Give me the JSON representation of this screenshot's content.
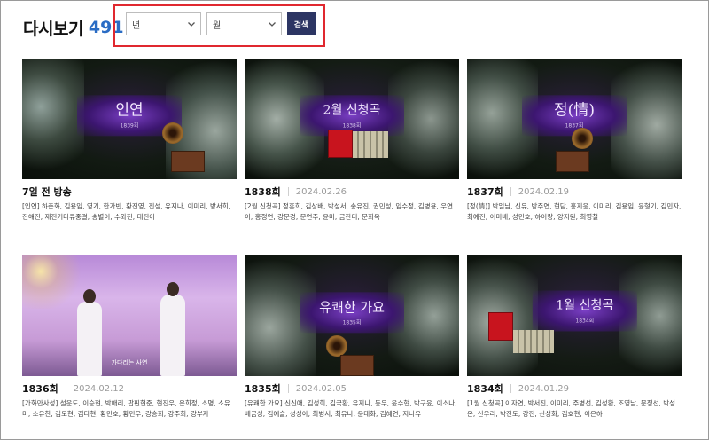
{
  "header": {
    "title": "다시보기",
    "count": "491"
  },
  "filters": {
    "year": "년",
    "month": "월",
    "search_label": "검색"
  },
  "cards": [
    {
      "banner_title": "인연",
      "banner_sub": "1839회",
      "episode": "7일 전 방송",
      "date": "",
      "cast": "[인연] 하춘화, 김용임, 영기, 한가빈, 황진영, 진성, 유지나, 이미리, 방서희, 진해진, 재진기타류중걸, 송별이, 수와진, 태진아"
    },
    {
      "banner_title": "2월 신청곡",
      "banner_sub": "1838회",
      "episode": "1838회",
      "date": "2024.02.26",
      "cast": "[2월 신청곡] 정훈희, 김상배, 박성서, 송유진, 권민성, 임수정, 김병용, 우연이, 홍정연, 강문경, 문연주, 윤미, 금잔디, 문희옥"
    },
    {
      "banner_title": "정(情)",
      "banner_sub": "1837회",
      "episode": "1837회",
      "date": "2024.02.19",
      "cast": "[정(情)] 박일남, 신유, 방주연, 현담, 홍지윤, 이미리, 김용임, 윤형기, 김민자, 최예진, 이미배, 성민호, 하이량, 양지원, 최영철"
    },
    {
      "banner_title": "",
      "banner_sub": "",
      "caption": "가다리는 사연",
      "episode": "1836회",
      "date": "2024.02.12",
      "cast": "[가화만사성] 설운도, 이승현, 박애리, 팝핀현준, 현진우, 은희정, 소명, 소유미, 소유찬, 김도현, 김다현, 황민호, 황민우, 강승희, 강주희, 강부자"
    },
    {
      "banner_title": "유쾌한 가요",
      "banner_sub": "1835회",
      "episode": "1835회",
      "date": "2024.02.05",
      "cast": "[유쾌한 가요] 신신애, 김성희, 김국환, 유지나, 동우, 윤수현, 박구윤, 이소나, 배금성, 김예슬, 성성아, 최병서, 최유나, 윤태화, 김혜연, 지나유"
    },
    {
      "banner_title": "1월 신청곡",
      "banner_sub": "1834회",
      "episode": "1834회",
      "date": "2024.01.29",
      "cast": "[1월 신청곡] 이자연, 박서진, 이미리, 주병선, 김성환, 조영남, 문정선, 박성온, 신우리, 박진도, 강진, 신성화, 김호현, 이은하"
    }
  ],
  "colors": {
    "accent": "#2a6cc4",
    "button_bg": "#2c3563",
    "highlight_border": "#e0282f"
  }
}
